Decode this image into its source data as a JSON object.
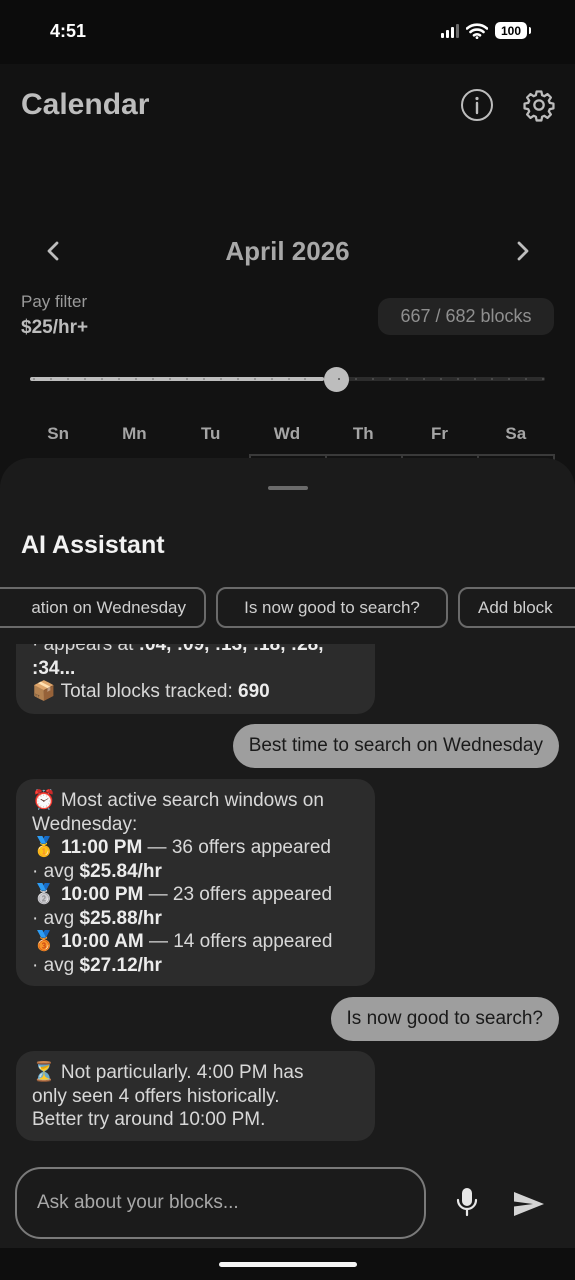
{
  "status_bar": {
    "time": "4:51",
    "battery": "100"
  },
  "calendar": {
    "title": "Calendar",
    "month": "April 2026",
    "pay_filter_label": "Pay filter",
    "pay_filter_value": "$25/hr+",
    "blocks_count": "667 / 682 blocks",
    "slider_fraction": 0.57,
    "weekdays": [
      "Sn",
      "Mn",
      "Tu",
      "Wd",
      "Th",
      "Fr",
      "Sa"
    ]
  },
  "assistant": {
    "title": "AI Assistant",
    "suggestions": [
      "ation on Wednesday",
      "Is now good to search?",
      "Add block"
    ],
    "messages": {
      "m1": {
        "l1_pre": "· appears at ",
        "l1_bold": ":04, :09, :13, :18, :28,",
        "l2": ":34...",
        "l3_icon": "📦",
        "l3_text": " Total blocks tracked: ",
        "l3_bold": "690"
      },
      "m2": "Best time to search on Wednesday",
      "m3": {
        "l1": "⏰ Most active search windows on",
        "l2": "Wednesday:",
        "r1_icon": "🥇",
        "r1_time": "11:00 PM",
        "r1_text": " — 36 offers appeared",
        "r1_avg_pre": "· avg ",
        "r1_avg": "$25.84/hr",
        "r2_icon": "🥈",
        "r2_time": "10:00 PM",
        "r2_text": " — 23 offers appeared",
        "r2_avg_pre": "· avg ",
        "r2_avg": "$25.88/hr",
        "r3_icon": "🥉",
        "r3_time": "10:00 AM",
        "r3_text": " — 14 offers appeared",
        "r3_avg_pre": "· avg ",
        "r3_avg": "$27.12/hr"
      },
      "m4": "Is now good to search?",
      "m5": {
        "l1": "⏳ Not particularly. 4:00 PM has",
        "l2": "only seen 4 offers historically.",
        "l3": "Better try around 10:00 PM."
      }
    },
    "input_placeholder": "Ask about your blocks..."
  },
  "colors": {
    "accent": "#bdbdbd",
    "sheet": "#1b1b1b",
    "ai_bubble": "#2c2c2c",
    "user_bubble": "#9e9e9e"
  },
  "icons": [
    "info-icon",
    "gear-icon",
    "chevron-left-icon",
    "chevron-right-icon",
    "microphone-icon",
    "send-icon"
  ]
}
